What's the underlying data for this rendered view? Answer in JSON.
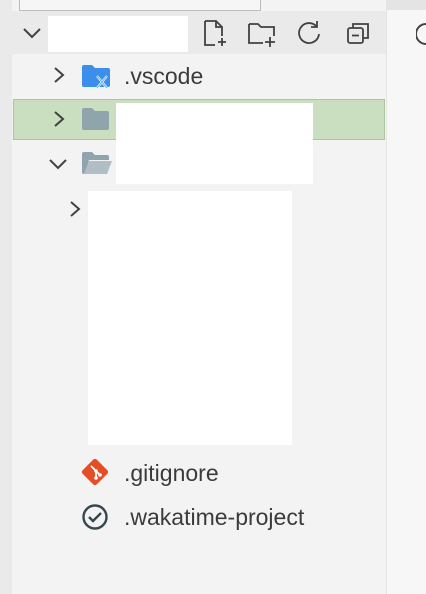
{
  "explorer": {
    "items": [
      {
        "label": ".vscode",
        "icon": "vscode-folder-icon"
      },
      {
        "label": ".gitignore",
        "icon": "git-icon"
      },
      {
        "label": ".wakatime-project",
        "icon": "wakatime-icon"
      }
    ]
  },
  "colors": {
    "selected_background": "#c9dfbf",
    "folder_blue": "#3b8eea",
    "folder_gray": "#90a4ae",
    "git_orange": "#e44d26",
    "text": "#3b3b3b"
  }
}
